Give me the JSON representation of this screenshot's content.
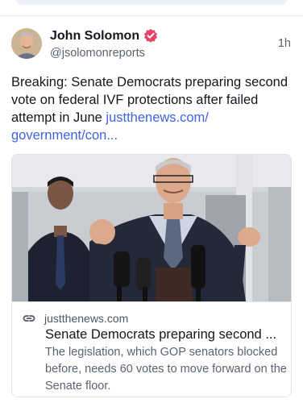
{
  "post": {
    "author_name": "John Solomon",
    "handle": "@jsolomonreports",
    "time": "1h",
    "text": "Breaking: Senate Democrats preparing second vote on federal IVF protections after failed attempt in June ",
    "link_text": "justthenews.com/ government/con..."
  },
  "link_card": {
    "domain": "justthenews.com",
    "title": "Senate Democrats preparing second ...",
    "description": "The legislation, which GOP senators blocked before, needs 60 votes to move forward on the Senate floor."
  },
  "icons": {
    "verified": "verified-badge-icon",
    "link": "link-icon"
  },
  "colors": {
    "link": "#3f63e0",
    "verified_badge": "#e8436b",
    "muted_text": "#5c6270"
  }
}
